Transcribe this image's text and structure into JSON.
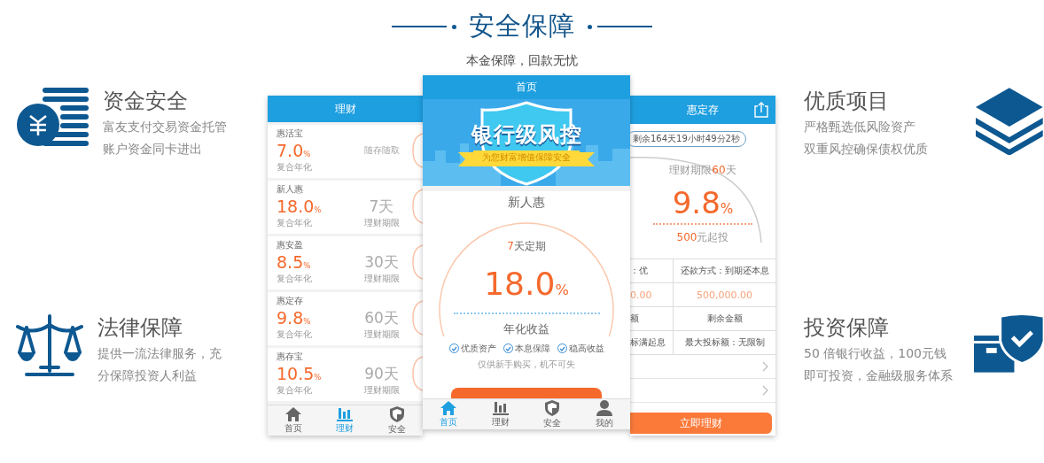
{
  "header": {
    "title": "安全保障",
    "subtitle": "本金保障，回款无忧"
  },
  "features_left": [
    {
      "kind": "coins",
      "title": "资金安全",
      "lines": [
        "富友支付交易资金托管",
        "账户资金同卡进出"
      ]
    },
    {
      "kind": "scale",
      "title": "法律保障",
      "lines": [
        "提供一流法律服务，充",
        "分保障投资人利益"
      ]
    }
  ],
  "features_right": [
    {
      "kind": "layers",
      "title": "优质项目",
      "lines": [
        "严格甄选低风险资产",
        "双重风控确保债权优质"
      ]
    },
    {
      "kind": "shield-card",
      "title": "投资保障",
      "lines": [
        "50 倍银行收益，100元钱",
        "即可投资，金融级服务体系"
      ]
    }
  ],
  "left_phone": {
    "title": "理财",
    "products": [
      {
        "kind": "flexible",
        "name": "惠活宝",
        "rate": "7.0",
        "unit": "%",
        "rate_label": "复合年化",
        "term": "随存随取"
      },
      {
        "kind": "fixed",
        "name": "新人惠",
        "rate": "18.0",
        "unit": "%",
        "rate_label": "复合年化",
        "term": "7天",
        "term_label": "理财期限"
      },
      {
        "kind": "fixed",
        "name": "惠安盈",
        "rate": "8.5",
        "unit": "%",
        "rate_label": "复合年化",
        "term": "30天",
        "term_label": "理财期限"
      },
      {
        "kind": "fixed",
        "name": "惠定存",
        "rate": "9.8",
        "unit": "%",
        "rate_label": "复合年化",
        "term": "60天",
        "term_label": "理财期限"
      },
      {
        "kind": "fixed",
        "name": "惠存宝",
        "rate": "10.5",
        "unit": "%",
        "rate_label": "复合年化",
        "term": "90天",
        "term_label": "理财期限"
      }
    ],
    "tabs": [
      {
        "kind": "home",
        "label": "首页",
        "selected": false
      },
      {
        "kind": "chart",
        "label": "理财",
        "selected": true
      },
      {
        "kind": "shield",
        "label": "安全",
        "selected": false
      }
    ]
  },
  "middle_phone": {
    "title": "首页",
    "banner": {
      "headline": "银行级风控",
      "ribbon": "为您财富增值保障安全"
    },
    "product": {
      "name": "新人惠",
      "term_highlight": "7",
      "term_text": "天定期",
      "rate": "18.0",
      "unit": "%",
      "rate_label": "年化收益",
      "features": [
        {
          "label": "优质资产",
          "checked": true
        },
        {
          "label": "本息保障",
          "checked": true
        },
        {
          "label": "稳高收益",
          "checked": true
        }
      ],
      "note": "仅供新手购买，机不可失"
    },
    "tabs": [
      {
        "kind": "home",
        "label": "首页",
        "selected": true
      },
      {
        "kind": "chart",
        "label": "理财",
        "selected": false
      },
      {
        "kind": "shield",
        "label": "安全",
        "selected": false
      },
      {
        "kind": "person",
        "label": "我的",
        "selected": false
      }
    ]
  },
  "right_phone": {
    "title": "惠定存",
    "countdown": "剩余164天19小时49分2秒",
    "term_prefix": "理财期限",
    "term_highlight": "60",
    "term_suffix": "天",
    "rate": "9.8",
    "unit": "%",
    "min_highlight": "500",
    "min_suffix": "元起投",
    "details": [
      {
        "kind": "text",
        "cells": [
          "：优",
          "还款方式：到期还本息"
        ]
      },
      {
        "kind": "amount",
        "cells": [
          "0.00",
          "500,000.00"
        ]
      },
      {
        "kind": "text",
        "cells": [
          "额",
          "剩余金额"
        ]
      },
      {
        "kind": "text",
        "cells": [
          "标满起息",
          "最大投标额：无限制"
        ]
      }
    ],
    "button": "立即理财"
  }
}
